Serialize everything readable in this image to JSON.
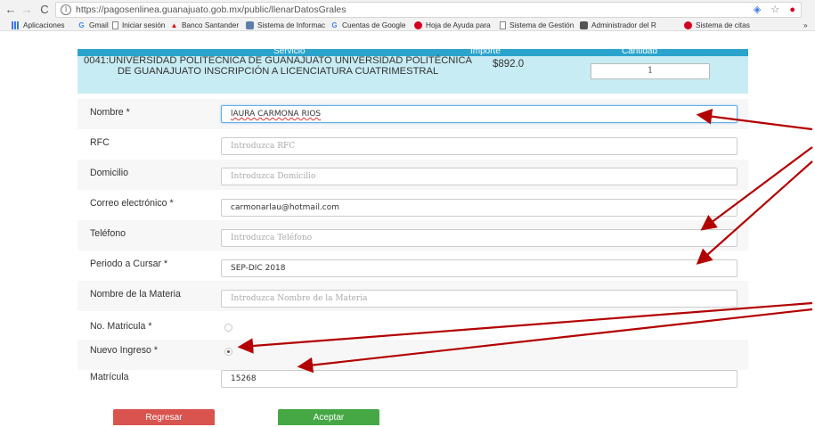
{
  "browser": {
    "url": "https://pagosenlinea.guanajuato.gob.mx/public/llenarDatosGrales",
    "bookmarks": [
      {
        "label": "Aplicaciones",
        "icon": "apps-icon"
      },
      {
        "label": "Gmail",
        "icon": "google-icon"
      },
      {
        "label": "Iniciar sesión",
        "icon": "page-icon"
      },
      {
        "label": "Banco Santander",
        "icon": "santander-icon"
      },
      {
        "label": "Sistema de Informac",
        "icon": "site-icon"
      },
      {
        "label": "Cuentas de Google",
        "icon": "google-icon"
      },
      {
        "label": "Hoja de Ayuda para",
        "icon": "red-dot-icon"
      },
      {
        "label": "Sistema de Gestión",
        "icon": "page-icon"
      },
      {
        "label": "Administrador del R",
        "icon": "admin-icon"
      },
      {
        "label": "Sistema de citas",
        "icon": "red-dot-icon"
      }
    ],
    "more": "»"
  },
  "service": {
    "header_service": "Servicio",
    "header_price": "Importe",
    "header_qty": "Cantidad",
    "name": "0041:UNIVERSIDAD POLITECNICA DE GUANAJUATO UNIVERSIDAD POLITÉCNICA DE GUANAJUATO INSCRIPCIÓN A LICENCIATURA CUATRIMESTRAL",
    "price": "$892.0",
    "qty": "1"
  },
  "form": {
    "nombre": {
      "label": "Nombre *",
      "value": "lAURA CARMONA RIOS"
    },
    "rfc": {
      "label": "RFC",
      "placeholder": "Introduzca RFC"
    },
    "domicilio": {
      "label": "Domicilio",
      "placeholder": "Introduzca Domicilio"
    },
    "correo": {
      "label": "Correo electrónico *",
      "value": "carmonarlau@hotmail.com"
    },
    "telefono": {
      "label": "Teléfono",
      "placeholder": "Introduzca Teléfono"
    },
    "periodo": {
      "label": "Periodo a Cursar *",
      "value": "SEP-DIC 2018"
    },
    "materia": {
      "label": "Nombre de la Materia",
      "placeholder": "Introduzca Nombre de la Materia"
    },
    "no_matricula": {
      "label": "No. Matricula *",
      "checked": false
    },
    "nuevo_ingreso": {
      "label": "Nuevo Ingreso *",
      "checked": true
    },
    "matricula": {
      "label": "Matrícula",
      "value": "15268"
    }
  },
  "buttons": {
    "back": "Regresar",
    "accept": "Aceptar"
  },
  "colors": {
    "annotation_arrow": "#b30000",
    "header_blue": "#2aa4cc",
    "service_bg": "#c8ecf3",
    "back_red": "#d9534f",
    "accept_green": "#45a845"
  }
}
